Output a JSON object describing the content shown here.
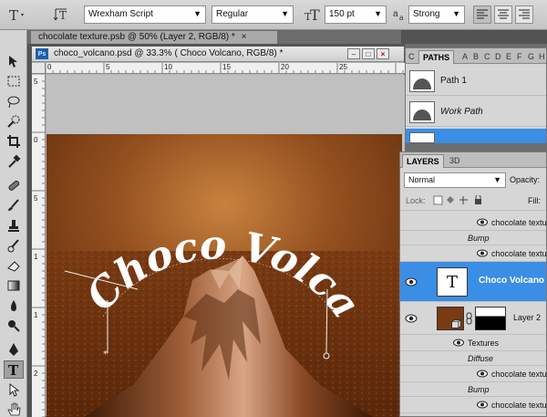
{
  "options_bar": {
    "font_family": "Wrexham Script",
    "font_style": "Regular",
    "font_size": "150 pt",
    "antialias_label": "a",
    "antialias_sub": "a",
    "antialias": "Strong",
    "size_icon_label": "T"
  },
  "tabs": {
    "background_doc": "chocolate texture.psb @ 50% (Layer 2, RGB/8) *",
    "background_close": "×"
  },
  "document": {
    "title": "choco_volcano.psd @ 33.3% (  Choco Volcano, RGB/8) *",
    "ps_icon": "Ps",
    "minimize": "–",
    "maximize": "□",
    "close": "×",
    "canvas_text": "Choco Volcano",
    "ruler_top": [
      "0",
      "5",
      "10",
      "15",
      "20",
      "25"
    ],
    "ruler_left": [
      "5",
      "0",
      "5",
      "1",
      "1",
      "2"
    ]
  },
  "paths_panel": {
    "tabs": [
      "PATHS",
      "A",
      "B",
      "C",
      "D",
      "E",
      "F",
      "G",
      "H"
    ],
    "side_icon": "C",
    "items": [
      {
        "name": "Path 1"
      },
      {
        "name": "Work Path"
      }
    ]
  },
  "layers_panel": {
    "tabs": [
      "LAYERS",
      "3D"
    ],
    "blend_mode": "Normal",
    "opacity_label": "Opacity:",
    "lock_label": "Lock:",
    "fill_label": "Fill:",
    "rows": [
      {
        "label": "chocolate textu"
      },
      {
        "label": "Bump"
      },
      {
        "label": "chocolate textu"
      },
      {
        "label": "Choco Volcano",
        "thumb": "T"
      },
      {
        "label": "Layer 2"
      },
      {
        "label": "Textures"
      },
      {
        "label": "Diffuse"
      },
      {
        "label": "chocolate textu"
      },
      {
        "label": "Bump"
      },
      {
        "label": "chocolate textu"
      }
    ]
  },
  "colors": {
    "selected_layer": "#3b8ee5",
    "chocolate_dark": "#4a2208",
    "chocolate_light": "#c2763a"
  }
}
